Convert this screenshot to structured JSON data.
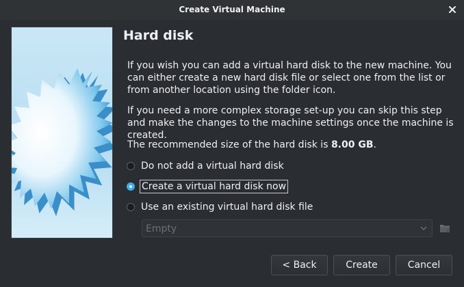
{
  "window": {
    "title": "Create Virtual Machine",
    "close_icon": "close-icon"
  },
  "page": {
    "heading": "Hard disk",
    "paragraph1": "If you wish you can add a virtual hard disk to the new machine. You can either create a new hard disk file or select one from the list or from another location using the folder icon.",
    "paragraph2": "If you need a more complex storage set-up you can skip this step and make the changes to the machine settings once the machine is created.",
    "recommended_prefix": "The recommended size of the hard disk is ",
    "recommended_size": "8.00 GB",
    "recommended_suffix": "."
  },
  "options": [
    {
      "label": "Do not add a virtual hard disk",
      "checked": false
    },
    {
      "label": "Create a virtual hard disk now",
      "checked": true
    },
    {
      "label": "Use an existing virtual hard disk file",
      "checked": false
    }
  ],
  "disk_select": {
    "value": "Empty",
    "enabled": false
  },
  "buttons": {
    "back": "< Back",
    "create": "Create",
    "cancel": "Cancel"
  },
  "colors": {
    "accent": "#3daee9",
    "background": "#2a2e32",
    "titlebar": "#2f3336"
  }
}
